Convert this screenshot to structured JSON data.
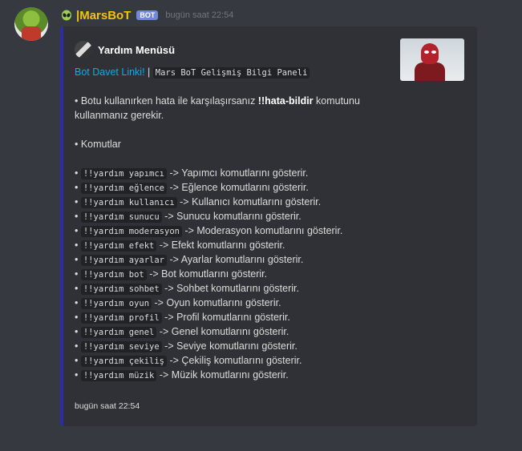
{
  "message": {
    "username": "|MarsBoT",
    "badge": "BOT",
    "timestamp": "bugün saat 22:54"
  },
  "embed": {
    "author": "Yardım Menüsü",
    "link_text": "Bot Davet Linki!",
    "separator": " | ",
    "panel_label": "Mars BoT Gelişmiş Bilgi Paneli",
    "intro_pre": "• Botu kullanırken hata ile karşılaşırsanız ",
    "intro_cmd": "!!hata-bildir",
    "intro_post": " komutunu kullanmanız gerekir.",
    "commands_heading": "• Komutlar",
    "bullet": "• ",
    "commands": [
      {
        "cmd": "!!yardım yapımcı",
        "desc": " -> Yapımcı komutlarını gösterir."
      },
      {
        "cmd": "!!yardım eğlence",
        "desc": " -> Eğlence komutlarını gösterir."
      },
      {
        "cmd": "!!yardım kullanıcı",
        "desc": " -> Kullanıcı komutlarını gösterir."
      },
      {
        "cmd": "!!yardım sunucu",
        "desc": " -> Sunucu komutlarını gösterir."
      },
      {
        "cmd": "!!yardım moderasyon",
        "desc": " -> Moderasyon komutlarını gösterir."
      },
      {
        "cmd": "!!yardım efekt",
        "desc": " -> Efekt komutlarını gösterir."
      },
      {
        "cmd": "!!yardım ayarlar",
        "desc": " -> Ayarlar komutlarını gösterir."
      },
      {
        "cmd": "!!yardım bot",
        "desc": " -> Bot komutlarını gösterir."
      },
      {
        "cmd": "!!yardım sohbet",
        "desc": " -> Sohbet komutlarını gösterir."
      },
      {
        "cmd": "!!yardım oyun",
        "desc": " -> Oyun komutlarını gösterir."
      },
      {
        "cmd": "!!yardım profil",
        "desc": " -> Profil komutlarını gösterir."
      },
      {
        "cmd": "!!yardım genel",
        "desc": " -> Genel komutlarını gösterir."
      },
      {
        "cmd": "!!yardım seviye",
        "desc": " -> Seviye komutlarını gösterir."
      },
      {
        "cmd": "!!yardım çekiliş",
        "desc": " -> Çekiliş komutlarını gösterir."
      },
      {
        "cmd": "!!yardım müzik",
        "desc": " -> Müzik komutlarını gösterir."
      }
    ],
    "footer": "bugün saat 22:54"
  },
  "colors": {
    "background": "#36393f",
    "embed_bg": "#2f3136",
    "embed_border": "#2c2ca8",
    "username": "#f1c40f",
    "link": "#00aff4",
    "badge": "#7289da"
  },
  "icons": {
    "alien": "alien-icon",
    "avatar": "bot-avatar"
  }
}
